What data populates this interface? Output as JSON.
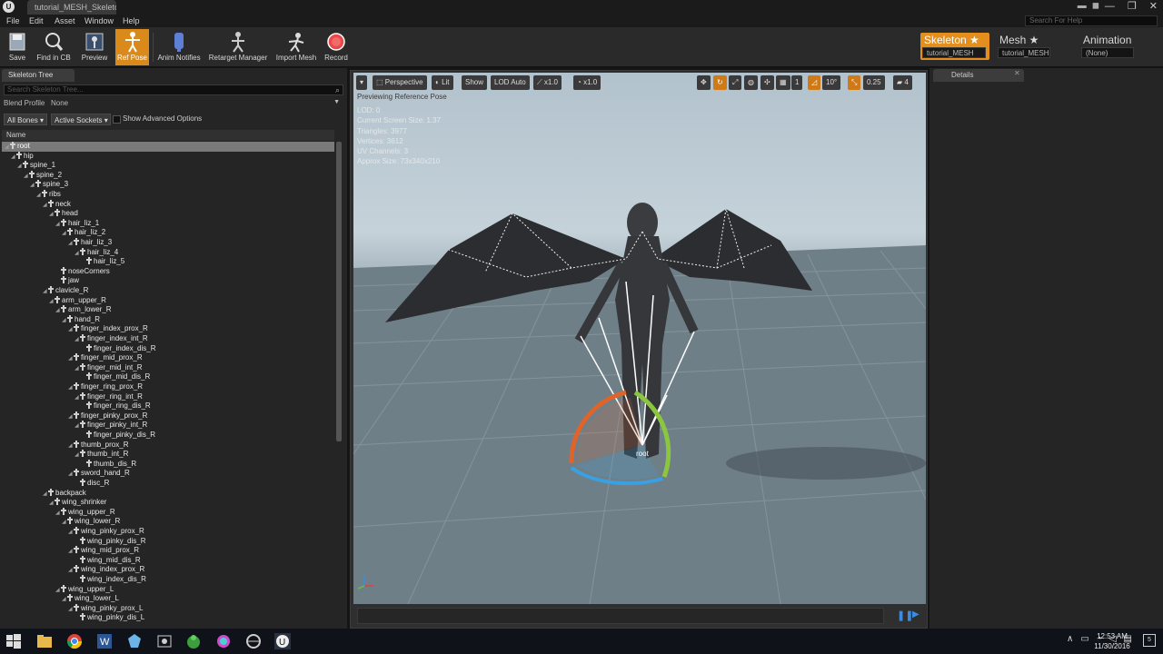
{
  "window": {
    "tab_title": "tutorial_MESH_Skeleton",
    "controls": [
      "—",
      "❐",
      "✕"
    ]
  },
  "menu": [
    "File",
    "Edit",
    "Asset",
    "Window",
    "Help"
  ],
  "search_help_placeholder": "Search For Help",
  "toolbar": {
    "buttons": [
      {
        "label": "Save",
        "icon": "save-icon"
      },
      {
        "label": "Find in CB",
        "icon": "find-icon"
      },
      {
        "label": "Preview",
        "icon": "preview-icon"
      },
      {
        "label": "Ref Pose",
        "icon": "ref-pose-icon",
        "active": true
      },
      {
        "label": "Anim Notifies",
        "icon": "anim-notifies-icon"
      },
      {
        "label": "Retarget Manager",
        "icon": "retarget-icon"
      },
      {
        "label": "Import Mesh",
        "icon": "import-icon"
      },
      {
        "label": "Record",
        "icon": "record-icon"
      }
    ]
  },
  "modes": [
    {
      "name": "Skeleton",
      "value": "tutorial_MESH",
      "active": true
    },
    {
      "name": "Mesh",
      "value": "tutorial_MESH"
    },
    {
      "name": "Animation",
      "value": "(None)"
    }
  ],
  "skeleton_tree": {
    "tab": "Skeleton Tree",
    "search_placeholder": "Search Skeleton Tree...",
    "blend_profile_label": "Blend Profile",
    "blend_profile_value": "None",
    "all_bones": "All Bones",
    "active_sockets": "Active Sockets",
    "show_advanced": "Show Advanced Options",
    "column_name": "Name",
    "bones": [
      {
        "name": "root",
        "depth": 0
      },
      {
        "name": "hip",
        "depth": 1
      },
      {
        "name": "spine_1",
        "depth": 2
      },
      {
        "name": "spine_2",
        "depth": 3
      },
      {
        "name": "spine_3",
        "depth": 4
      },
      {
        "name": "ribs",
        "depth": 5
      },
      {
        "name": "neck",
        "depth": 6
      },
      {
        "name": "head",
        "depth": 7
      },
      {
        "name": "hair_liz_1",
        "depth": 8
      },
      {
        "name": "hair_liz_2",
        "depth": 9
      },
      {
        "name": "hair_liz_3",
        "depth": 10
      },
      {
        "name": "hair_liz_4",
        "depth": 11
      },
      {
        "name": "hair_liz_5",
        "depth": 12
      },
      {
        "name": "noseCorners",
        "depth": 8
      },
      {
        "name": "jaw",
        "depth": 8
      },
      {
        "name": "clavicle_R",
        "depth": 6
      },
      {
        "name": "arm_upper_R",
        "depth": 7
      },
      {
        "name": "arm_lower_R",
        "depth": 8
      },
      {
        "name": "hand_R",
        "depth": 9
      },
      {
        "name": "finger_index_prox_R",
        "depth": 10
      },
      {
        "name": "finger_index_int_R",
        "depth": 11
      },
      {
        "name": "finger_index_dis_R",
        "depth": 12
      },
      {
        "name": "finger_mid_prox_R",
        "depth": 10
      },
      {
        "name": "finger_mid_int_R",
        "depth": 11
      },
      {
        "name": "finger_mid_dis_R",
        "depth": 12
      },
      {
        "name": "finger_ring_prox_R",
        "depth": 10
      },
      {
        "name": "finger_ring_int_R",
        "depth": 11
      },
      {
        "name": "finger_ring_dis_R",
        "depth": 12
      },
      {
        "name": "finger_pinky_prox_R",
        "depth": 10
      },
      {
        "name": "finger_pinky_int_R",
        "depth": 11
      },
      {
        "name": "finger_pinky_dis_R",
        "depth": 12
      },
      {
        "name": "thumb_prox_R",
        "depth": 10
      },
      {
        "name": "thumb_int_R",
        "depth": 11
      },
      {
        "name": "thumb_dis_R",
        "depth": 12
      },
      {
        "name": "sword_hand_R",
        "depth": 10
      },
      {
        "name": "disc_R",
        "depth": 11
      },
      {
        "name": "backpack",
        "depth": 6
      },
      {
        "name": "wing_shrinker",
        "depth": 7
      },
      {
        "name": "wing_upper_R",
        "depth": 8
      },
      {
        "name": "wing_lower_R",
        "depth": 9
      },
      {
        "name": "wing_pinky_prox_R",
        "depth": 10
      },
      {
        "name": "wing_pinky_dis_R",
        "depth": 11
      },
      {
        "name": "wing_mid_prox_R",
        "depth": 10
      },
      {
        "name": "wing_mid_dis_R",
        "depth": 11
      },
      {
        "name": "wing_index_prox_R",
        "depth": 10
      },
      {
        "name": "wing_index_dis_R",
        "depth": 11
      },
      {
        "name": "wing_upper_L",
        "depth": 8
      },
      {
        "name": "wing_lower_L",
        "depth": 9
      },
      {
        "name": "wing_pinky_prox_L",
        "depth": 10
      },
      {
        "name": "wing_pinky_dis_L",
        "depth": 11
      }
    ]
  },
  "viewport": {
    "buttons": {
      "perspective": "Perspective",
      "lit": "Lit",
      "show": "Show",
      "lod": "LOD Auto",
      "speed": "x1.0",
      "anim_speed": "x1.0",
      "grid_snap": "10°",
      "scale_snap": "0.25",
      "cam_speed": "4",
      "num_one": "1"
    },
    "preview_text": "Previewing Reference Pose",
    "stats": [
      "LOD: 0",
      "Current Screen Size: 1.37",
      "Triangles: 3977",
      "Vertices: 3612",
      "UV Channels: 3",
      "Approx Size: 73x340x210"
    ],
    "root_label": "root"
  },
  "details": {
    "tab": "Details"
  },
  "taskbar": {
    "time": "12:53 AM",
    "date": "11/30/2016",
    "notifications": "5"
  }
}
